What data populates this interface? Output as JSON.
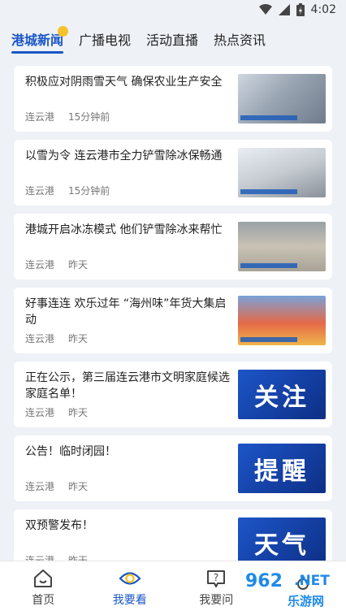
{
  "status": {
    "time": "4:02"
  },
  "tabs": [
    {
      "label": "港城新闻",
      "active": true
    },
    {
      "label": "广播电视"
    },
    {
      "label": "活动直播"
    },
    {
      "label": "热点资讯"
    }
  ],
  "news": [
    {
      "title": "积极应对阴雨雪天气 确保农业生产安全",
      "source": "连云港",
      "time": "15分钟前"
    },
    {
      "title": "以雪为令 连云港市全力铲雪除冰保畅通",
      "source": "连云港",
      "time": "15分钟前"
    },
    {
      "title": "港城开启冰冻模式 他们铲雪除冰来帮忙",
      "source": "连云港",
      "time": "昨天"
    },
    {
      "title": "好事连连 欢乐过年 “海州味”年货大集启动",
      "source": "连云港",
      "time": "昨天"
    },
    {
      "title": "正在公示，第三届连云港市文明家庭候选家庭名单！",
      "source": "连云港",
      "time": "昨天",
      "banner": "关注"
    },
    {
      "title": "公告！临时闭园！",
      "source": "连云港",
      "time": "昨天",
      "banner": "提醒"
    },
    {
      "title": "双预警发布！",
      "source": "连云港",
      "time": "昨天",
      "banner": "天气"
    }
  ],
  "bottom_nav": [
    {
      "label": "首页",
      "icon": "home-icon"
    },
    {
      "label": "我要看",
      "icon": "eye-icon",
      "active": true
    },
    {
      "label": "我要问",
      "icon": "question-icon"
    }
  ],
  "watermark": {
    "num": "962",
    "net": ".NET",
    "sub": "乐游网"
  },
  "colors": {
    "accent": "#1a56c5",
    "dot": "#f6c229",
    "background": "#eef1f6"
  }
}
